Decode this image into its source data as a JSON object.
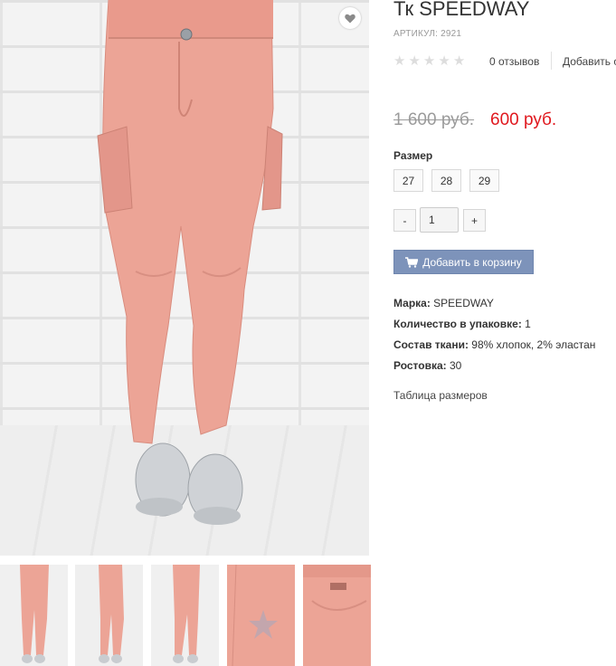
{
  "product": {
    "title": "Тк SPEEDWAY",
    "sku": "АРТИКУЛ: 2921",
    "rating_stars": 0,
    "reviews_label": "0 отзывов",
    "add_review_label": "Добавить о",
    "price_old": "1 600 руб.",
    "price_new": "600 руб."
  },
  "sizes": {
    "label": "Размер",
    "options": [
      "27",
      "28",
      "29"
    ]
  },
  "quantity": {
    "minus_label": "-",
    "value": "1",
    "plus_label": "+"
  },
  "cart": {
    "button_label": "Добавить в корзину",
    "icon": "shopping-cart-icon"
  },
  "specs": [
    {
      "label": "Марка:",
      "value": "SPEEDWAY"
    },
    {
      "label": "Количество в упаковке:",
      "value": "1"
    },
    {
      "label": "Состав ткани:",
      "value": "98% хлопок, 2% эластан"
    },
    {
      "label": "Ростовка:",
      "value": "30"
    }
  ],
  "size_table_link": "Таблица размеров",
  "icons": {
    "favorite": "heart-icon"
  },
  "colors": {
    "accent_price": "#e0181e",
    "cart_button": "#7d93ba",
    "pants": "#eca496"
  },
  "gallery": {
    "thumbnail_count": 5
  }
}
